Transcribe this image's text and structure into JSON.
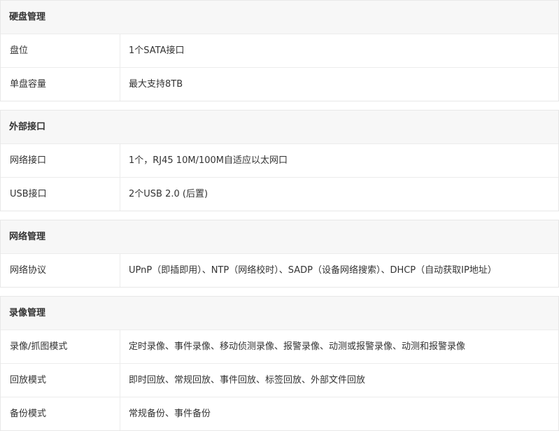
{
  "sections": [
    {
      "title": "硬盘管理",
      "rows": [
        {
          "key": "盘位",
          "value": "1个SATA接口"
        },
        {
          "key": "单盘容量",
          "value": "最大支持8TB"
        }
      ]
    },
    {
      "title": "外部接口",
      "rows": [
        {
          "key": "网络接口",
          "value": "1个，RJ45 10M/100M自适应以太网口"
        },
        {
          "key": "USB接口",
          "value": "2个USB 2.0 (后置)"
        }
      ]
    },
    {
      "title": "网络管理",
      "rows": [
        {
          "key": "网络协议",
          "value": "UPnP（即插即用）、NTP（网络校时）、SADP（设备网络搜索）、DHCP（自动获取IP地址）"
        }
      ]
    },
    {
      "title": "录像管理",
      "rows": [
        {
          "key": "录像/抓图模式",
          "value": "定时录像、事件录像、移动侦测录像、报警录像、动测或报警录像、动测和报警录像"
        },
        {
          "key": "回放模式",
          "value": "即时回放、常规回放、事件回放、标签回放、外部文件回放"
        },
        {
          "key": "备份模式",
          "value": "常规备份、事件备份"
        }
      ]
    }
  ]
}
